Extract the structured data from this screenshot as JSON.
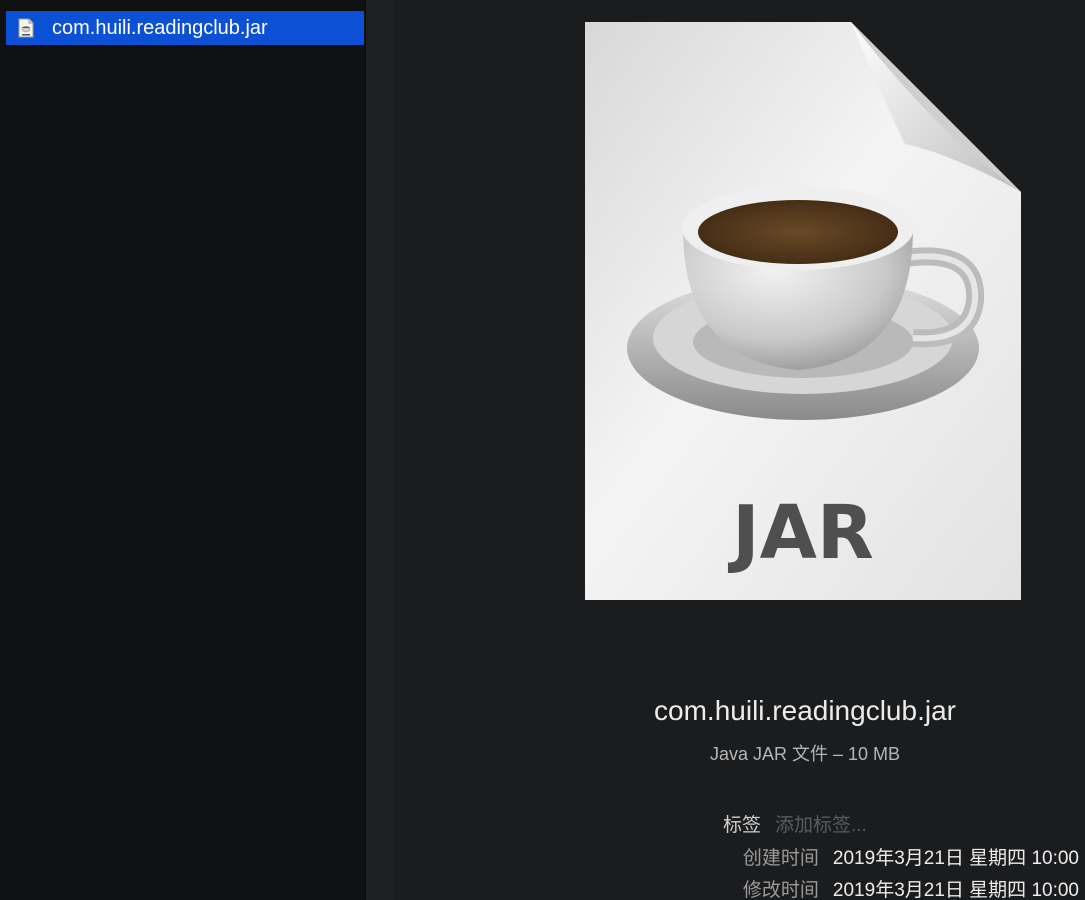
{
  "file_list": {
    "selected_item": {
      "label": "com.huili.readingclub.jar",
      "icon": "jar-file-icon"
    }
  },
  "preview": {
    "icon_text": "JAR",
    "icon": "jar-document-icon",
    "file_name": "com.huili.readingclub.jar",
    "file_kind": "Java JAR 文件 – 10 MB",
    "metadata": {
      "tags": {
        "label": "标签",
        "placeholder": "添加标签..."
      },
      "created": {
        "label": "创建时间",
        "value": "2019年3月21日 星期四 10:00"
      },
      "modified": {
        "label": "修改时间",
        "value": "2019年3月21日 星期四 10:00"
      }
    }
  },
  "colors": {
    "selection": "#0c50d6",
    "background": "#1b1c1e",
    "list_background": "#101113"
  }
}
